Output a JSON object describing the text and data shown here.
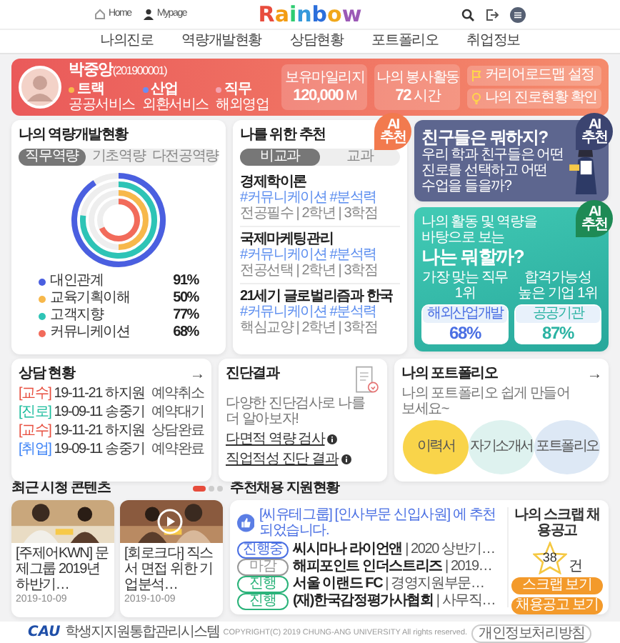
{
  "header": {
    "links": [
      {
        "label": "Home",
        "kind": "home"
      },
      {
        "label": "Mypage",
        "kind": "user"
      }
    ],
    "logo": "Rainbow",
    "actions": [
      {
        "kind": "search"
      },
      {
        "kind": "logout"
      },
      {
        "kind": "menu"
      }
    ]
  },
  "nav": [
    {
      "label": "나의진로"
    },
    {
      "label": "역량개발현황"
    },
    {
      "label": "상담현황"
    },
    {
      "label": "포트폴리오"
    },
    {
      "label": "취업정보"
    }
  ],
  "profile": {
    "name": "박중앙",
    "student_id": "(201900001)",
    "tags": [
      {
        "label": "트랙",
        "value": "공공서비스",
        "color": "#f7b84b"
      },
      {
        "label": "산업",
        "value": "외환서비스",
        "color": "#6c8cf2"
      },
      {
        "label": "직무",
        "value": "해외영업",
        "color": "#f5a3b0"
      }
    ],
    "stats": [
      {
        "label": "보유마일리지",
        "value": "120,000",
        "unit": "M"
      },
      {
        "label": "나의 봉사활동",
        "value": "72",
        "unit": "시간"
      }
    ],
    "buttons": [
      {
        "label": "커리어로드맵 설정",
        "kind": "flag"
      },
      {
        "label": "나의 진로현황 확인",
        "kind": "bulb"
      }
    ]
  },
  "skills": {
    "title": "나의 역량개발현황",
    "tabs": [
      {
        "label": "직무역량",
        "selected": true
      },
      {
        "label": "기초역량",
        "selected": false
      },
      {
        "label": "다전공역량",
        "selected": false
      }
    ],
    "items": [
      {
        "name": "대인관계",
        "value": "91%",
        "color": "#4a5fe0"
      },
      {
        "name": "교육기획이해",
        "value": "50%",
        "color": "#f7b84b"
      },
      {
        "name": "고객지향",
        "value": "77%",
        "color": "#2ec4b6"
      },
      {
        "name": "커뮤니케이션",
        "value": "68%",
        "color": "#f26b5b"
      }
    ]
  },
  "recommend": {
    "title": "나를 위한 추천",
    "badge": "AI 추천",
    "tabs": [
      {
        "label": "비교과",
        "selected": true
      },
      {
        "label": "교과",
        "selected": false
      }
    ],
    "items": [
      {
        "title": "경제학이론",
        "tags": "#커뮤니케이션 #분석력",
        "meta": "전공필수 | 2학년 | 3학점"
      },
      {
        "title": "국제마케팅관리",
        "tags": "#커뮤니케이션 #분석력",
        "meta": "전공선택 | 2학년 | 3학점"
      },
      {
        "title": "21세기 글로벌리즘과 한국",
        "tags": "#커뮤니케이션 #분석력",
        "meta": "핵심교양 | 2학년 | 3학점"
      }
    ]
  },
  "friends": {
    "title": "친구들은 뭐하지?",
    "text": "우리 학과 친구들은 어떤 진로를 선택하고 어떤 수업을 들을까?",
    "badge": "AI 추천"
  },
  "match": {
    "subtitle": "나의 활동 및 역량을 바탕으로 보는",
    "title": "나는 뭐할까?",
    "badge": "AI 추천",
    "results": [
      {
        "caption": "가장 맞는 직무 1위",
        "name": "해외산업개발",
        "value": "68%",
        "color": "#4a6fe3"
      },
      {
        "caption": "합격가능성 높은 기업 1위",
        "name": "공공기관",
        "value": "87%",
        "color": "#2bb3a3"
      }
    ]
  },
  "counsel": {
    "title": "상담 현황",
    "arrow": "→",
    "items": [
      {
        "type": "[교수]",
        "color": "#e74c3c",
        "text": "19-11-21 하지원",
        "status": "예약취소"
      },
      {
        "type": "[진로]",
        "color": "#1abc9c",
        "text": "19-09-11 송중기",
        "status": "예약대기"
      },
      {
        "type": "[교수]",
        "color": "#e74c3c",
        "text": "19-11-21 하지원",
        "status": "상담완료"
      },
      {
        "type": "[취업]",
        "color": "#3b82f6",
        "text": "19-09-11 송중기",
        "status": "예약완료"
      }
    ]
  },
  "diagnosis": {
    "title": "진단결과",
    "subtitle": "다양한 진단검사로 나를 더 알아보자!",
    "links": [
      "다면적 역량 검사",
      "직업적성 진단 결과"
    ]
  },
  "portfolio": {
    "title": "나의 포트폴리오",
    "arrow": "→",
    "subtitle": "나의 포트폴리오 쉽게 만들어 보세요~",
    "items": [
      {
        "label": "이력서",
        "color": "#f9d44a"
      },
      {
        "label": "자기소개서",
        "color": "#def2ef"
      },
      {
        "label": "포트폴리오",
        "color": "#dde8f5"
      }
    ]
  },
  "contents": {
    "title": "최근 시청 콘텐츠",
    "pager": [
      {
        "selected": true
      },
      {
        "selected": false
      },
      {
        "selected": false
      }
    ],
    "items": [
      {
        "kind": "picture",
        "play": false,
        "title": "[주제어KWN] 문제그룹 2019년 하반기…",
        "date": "2019-10-09"
      },
      {
        "kind": "picture",
        "play": true,
        "title": "[회로크다] 직스서 면접 위한 기업분석…",
        "date": "2019-10-09"
      }
    ]
  },
  "jobs": {
    "title": "추천채용 지원현황",
    "notice": "[씨유테그룹] [인사부문 신입사원] 에 추천 되었습니다.",
    "rows": [
      {
        "status": "진행중",
        "kind": "progress",
        "text": "**씨시마나 라이언앤** | 2020 상반기…"
      },
      {
        "status": "마감",
        "kind": "closed",
        "text": "**해피포인트 인더스트리즈** | 2019…"
      },
      {
        "status": "진행",
        "kind": "open",
        "text": "**서울 이랜드 FC** | 경영지원부문…"
      },
      {
        "status": "진행",
        "kind": "open",
        "text": "**(재)한국감정평가사협회** | 사무직…"
      }
    ],
    "scrap": {
      "title": "나의 스크랩 채용공고",
      "count": "38",
      "unit": "건",
      "buttons": [
        "스크랩 보기",
        "채용공고 보기"
      ]
    }
  },
  "footer": {
    "logo": "CAU",
    "system": "학생지지원통합관리시스템",
    "copyright": "COPYRIGHT(C) 2019 CHUNG-ANG UNIVERSITY All rights reserved.",
    "privacy": "개인정보처리방침"
  }
}
